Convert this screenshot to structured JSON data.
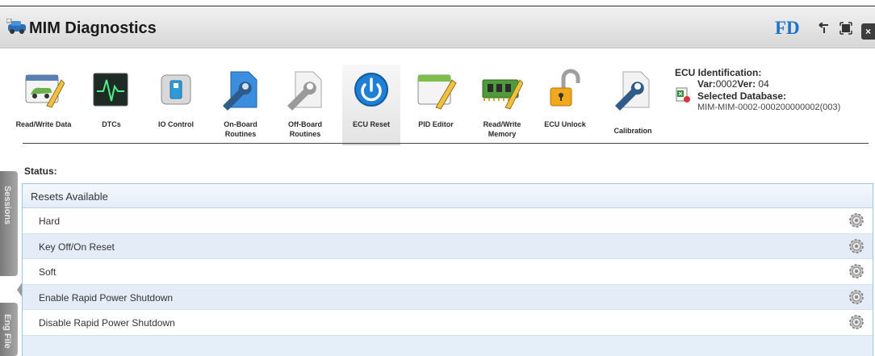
{
  "window": {
    "title": "MIM Diagnostics",
    "brand": "FD",
    "close_label": "×"
  },
  "toolbar": {
    "tools": [
      {
        "label": "Read/Write Data",
        "icon": "read-write-data-icon"
      },
      {
        "label": "DTCs",
        "icon": "dtc-monitor-icon"
      },
      {
        "label": "IO Control",
        "icon": "io-control-icon"
      },
      {
        "label": "On-Board Routines",
        "icon": "on-board-routines-icon"
      },
      {
        "label": "Off-Board Routines",
        "icon": "off-board-routines-icon"
      },
      {
        "label": "ECU Reset",
        "icon": "power-icon",
        "active": true
      },
      {
        "label": "PID Editor",
        "icon": "pid-editor-icon"
      },
      {
        "label": "Read/Write Memory",
        "icon": "memory-icon"
      },
      {
        "label": "ECU Unlock",
        "icon": "padlock-icon"
      },
      {
        "label": "Calibration",
        "icon": "calibration-icon"
      }
    ]
  },
  "ecu": {
    "heading": "ECU Identification:",
    "var_label": "Var:",
    "var_value": "0002",
    "ver_label": "Ver:",
    "ver_value": " 04",
    "db_label": "Selected Database:",
    "db_value": "MIM-MIM-0002-000200000002(003)"
  },
  "side_tabs": {
    "top": "Sessions",
    "bottom": "Eng File"
  },
  "status": {
    "label": "Status:"
  },
  "resets": {
    "header": "Resets Available",
    "items": [
      {
        "label": "Hard"
      },
      {
        "label": "Key Off/On Reset"
      },
      {
        "label": "Soft"
      },
      {
        "label": "Enable Rapid Power Shutdown"
      },
      {
        "label": "Disable Rapid Power Shutdown"
      }
    ]
  },
  "colors": {
    "accent": "#1f74c8",
    "panel_border": "#9fc3e2",
    "row_alt": "#e4edf7"
  }
}
